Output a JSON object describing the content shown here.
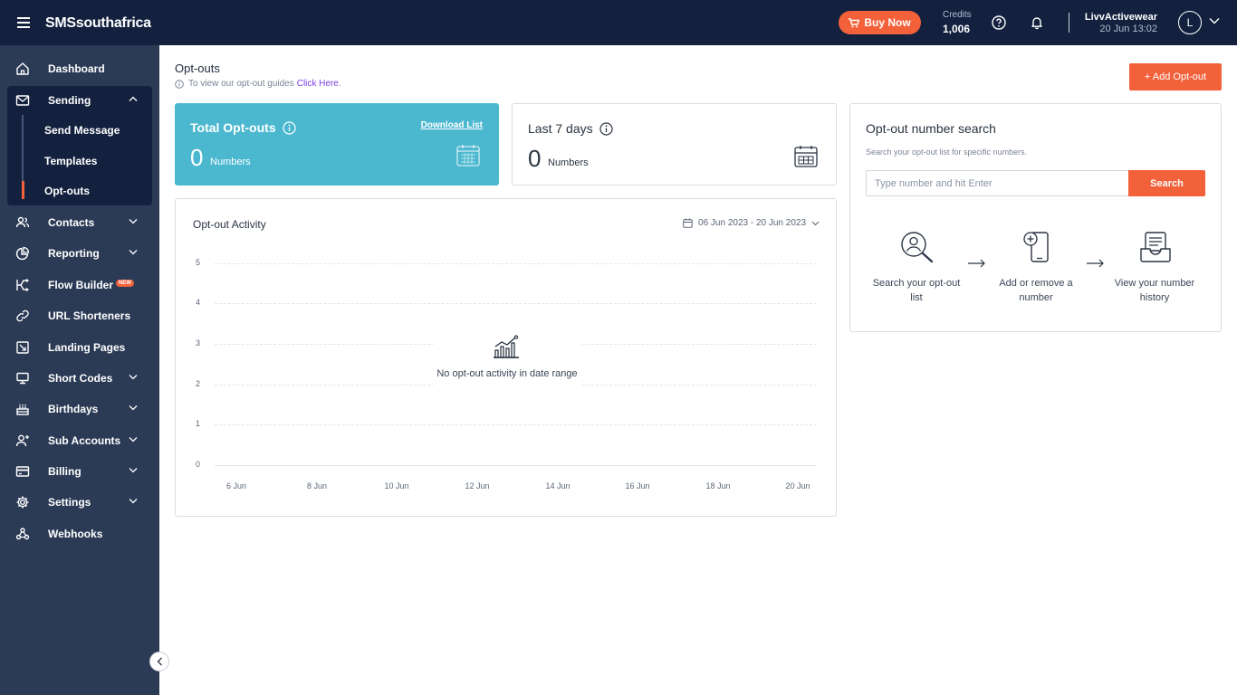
{
  "topbar": {
    "brand": "SMSsouthafrica",
    "buy_now": "Buy Now",
    "credits_label": "Credits",
    "credits_value": "1,006",
    "account_name": "LivvActivewear",
    "account_time": "20 Jun 13:02",
    "avatar_letter": "L"
  },
  "sidebar": {
    "dashboard": "Dashboard",
    "sending": "Sending",
    "send_message": "Send Message",
    "templates": "Templates",
    "opt_outs": "Opt-outs",
    "contacts": "Contacts",
    "reporting": "Reporting",
    "flow_builder": "Flow Builder",
    "new_badge": "NEW",
    "url_shorteners": "URL Shorteners",
    "landing_pages": "Landing Pages",
    "short_codes": "Short Codes",
    "birthdays": "Birthdays",
    "sub_accounts": "Sub Accounts",
    "billing": "Billing",
    "settings": "Settings",
    "webhooks": "Webhooks"
  },
  "page": {
    "title": "Opt-outs",
    "hint_text": "To view our opt-out guides",
    "hint_link": "Click Here",
    "add_button": "+ Add Opt-out"
  },
  "total_card": {
    "title": "Total Opt-outs",
    "download": "Download List",
    "value": "0",
    "unit": "Numbers"
  },
  "last7_card": {
    "title": "Last 7 days",
    "value": "0",
    "unit": "Numbers"
  },
  "activity": {
    "title": "Opt-out Activity",
    "date_range": "06 Jun 2023 - 20 Jun 2023",
    "empty_message": "No opt-out activity in date range",
    "y_ticks": [
      "5",
      "4",
      "3",
      "2",
      "1",
      "0"
    ],
    "x_ticks": [
      "6 Jun",
      "8 Jun",
      "10 Jun",
      "12 Jun",
      "14 Jun",
      "16 Jun",
      "18 Jun",
      "20 Jun"
    ]
  },
  "search": {
    "title": "Opt-out number search",
    "subtitle": "Search your opt-out list for specific numbers.",
    "placeholder": "Type number and hit Enter",
    "button": "Search",
    "step1": "Search your opt-out list",
    "step2": "Add or remove a number",
    "step3": "View your number history"
  },
  "colors": {
    "navy": "#13213f",
    "sidebar": "#2b3a55",
    "accent_orange": "#f2613a",
    "teal_card": "#4bb8d0",
    "link_purple": "#7b3fe4"
  }
}
